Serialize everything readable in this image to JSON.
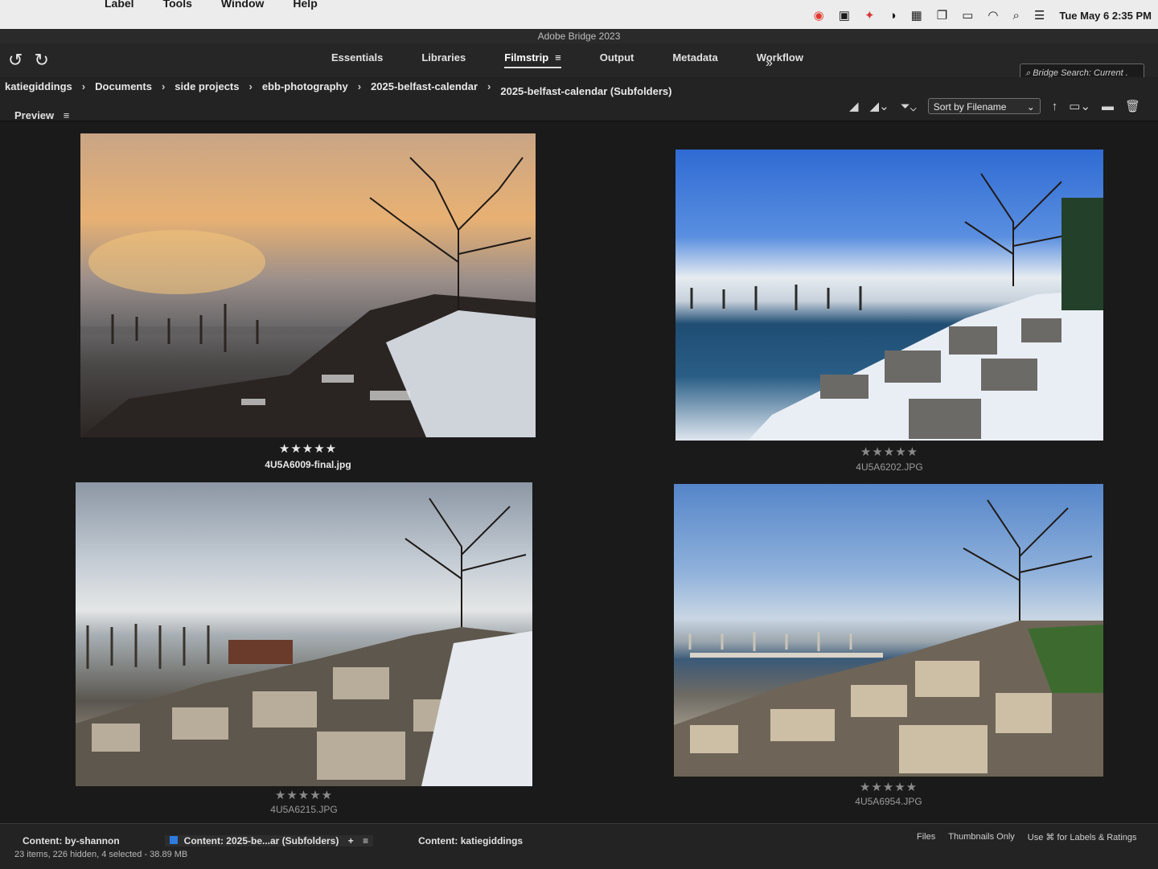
{
  "menubar": {
    "menus": [
      "Label",
      "Tools",
      "Window",
      "Help"
    ],
    "clock": "Tue May 6  2:35 PM",
    "icons": [
      "creative-cloud-icon",
      "finder-icon",
      "dropbox-icon",
      "extension-icon",
      "calendar-icon",
      "window-icon",
      "battery-icon",
      "wifi-icon",
      "search-icon",
      "control-center-icon"
    ]
  },
  "window": {
    "title": "Adobe Bridge 2023"
  },
  "workspaces": {
    "items": [
      {
        "label": "Essentials"
      },
      {
        "label": "Libraries"
      },
      {
        "label": "Filmstrip",
        "active": true
      },
      {
        "label": "Output"
      },
      {
        "label": "Metadata"
      },
      {
        "label": "Workflow"
      }
    ],
    "more": "»"
  },
  "search": {
    "placeholder": "Bridge Search: Current ."
  },
  "breadcrumb": [
    "katiegiddings",
    "Documents",
    "side projects",
    "ebb-photography",
    "2025-belfast-calendar",
    "2025-belfast-calendar (Subfolders)"
  ],
  "sort": {
    "label": "Sort by Filename"
  },
  "panel": {
    "title": "Preview"
  },
  "thumbnails": [
    {
      "file": "4U5A6009-final.jpg",
      "rating": 5,
      "stars": "★★★★★"
    },
    {
      "file": "4U5A6202.JPG",
      "rating": 5,
      "stars": "★★★★★"
    },
    {
      "file": "4U5A6215.JPG",
      "rating": 5,
      "stars": "★★★★★"
    },
    {
      "file": "4U5A6954.JPG",
      "rating": 5,
      "stars": "★★★★★"
    }
  ],
  "bottom": {
    "tabs": [
      {
        "label": "Content: by-shannon"
      },
      {
        "label": "Content: 2025-be...ar (Subfolders)",
        "active": true
      },
      {
        "label": "Content: katiegiddings"
      }
    ],
    "status": "23 items, 226 hidden, 4 selected - 38.89 MB",
    "options": [
      "Files",
      "Thumbnails Only",
      "Use ⌘ for Labels & Ratings"
    ]
  },
  "colors": {
    "accent": "#2d7be0",
    "star_active": "#e8e8e8",
    "star_dim": "#8a8a8a"
  }
}
